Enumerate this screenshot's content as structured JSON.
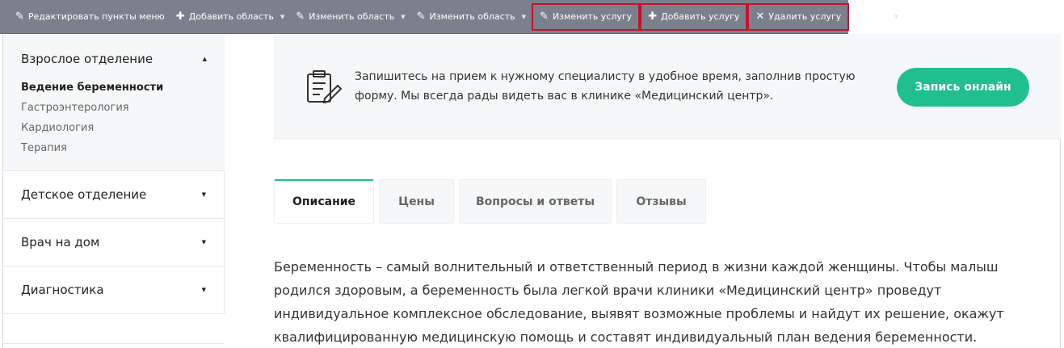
{
  "toolbar": {
    "items": [
      {
        "icon": "pencil-icon",
        "label": "Редактировать пункты меню",
        "caret": false,
        "highlighted": false
      },
      {
        "icon": "plus-icon",
        "label": "Добавить область",
        "caret": true,
        "highlighted": false
      },
      {
        "icon": "pencil-icon",
        "label": "Изменить область",
        "caret": true,
        "highlighted": false
      },
      {
        "icon": "pencil-icon",
        "label": "Изменить область",
        "caret": true,
        "highlighted": false
      },
      {
        "icon": "pencil-icon",
        "label": "Изменить услугу",
        "caret": false,
        "highlighted": true
      },
      {
        "icon": "plus-icon",
        "label": "Добавить услугу",
        "caret": false,
        "highlighted": true
      },
      {
        "icon": "close-icon",
        "label": "Удалить услугу",
        "caret": false,
        "highlighted": true
      }
    ],
    "extra_icons": [
      "pin-icon",
      "gear-icon"
    ],
    "highlight_color": "#c8102e"
  },
  "sidebar": {
    "open_group": {
      "label": "Взрослое отделение",
      "items": [
        "Ведение беременности",
        "Гастроэнтерология",
        "Кардиология",
        "Терапия"
      ],
      "active": "Ведение беременности"
    },
    "groups": [
      "Детское отделение",
      "Врач на дом",
      "Диагностика"
    ]
  },
  "banner": {
    "icon": "clipboard-form-icon",
    "text": "Запишитесь на прием к нужному специалисту в удобное время, заполнив простую форму. Мы всегда рады видеть вас в клинике «Медицинский центр».",
    "button_label": "Запись онлайн",
    "accent": "#1fbf8f"
  },
  "tabs": [
    {
      "label": "Описание",
      "active": true
    },
    {
      "label": "Цены",
      "active": false
    },
    {
      "label": "Вопросы и ответы",
      "active": false
    },
    {
      "label": "Отзывы",
      "active": false
    }
  ],
  "article": {
    "text": "Беременность – самый волнительный и ответственный период в жизни каждой женщины. Чтобы малыш родился здоровым, а беременность была легкой врачи клиники «Медицинский центр» проведут индивидуальное комплексное обследование, выявят возможные проблемы и найдут их решение, окажут квалифицированную медицинскую помощь и составят индивидуальный план ведения беременности."
  }
}
